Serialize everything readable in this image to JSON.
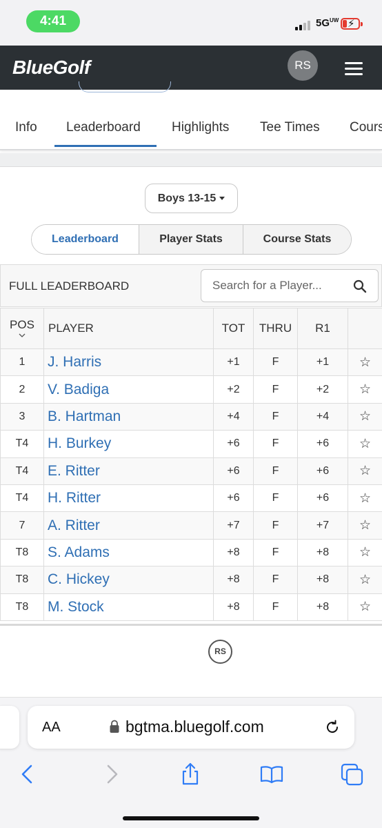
{
  "status_bar": {
    "time": "4:41",
    "network": "5G",
    "network_suffix": "UW",
    "battery_color": "#e43a2f"
  },
  "header": {
    "logo": "BlueGolf",
    "avatar_initials": "RS",
    "background": "#2b3034"
  },
  "tabs": [
    {
      "label": "Info",
      "active": false
    },
    {
      "label": "Leaderboard",
      "active": true
    },
    {
      "label": "Highlights",
      "active": false
    },
    {
      "label": "Tee Times",
      "active": false
    },
    {
      "label": "Cours",
      "active": false
    }
  ],
  "division": {
    "selected": "Boys 13-15"
  },
  "segments": [
    {
      "label": "Leaderboard",
      "active": true
    },
    {
      "label": "Player Stats",
      "active": false
    },
    {
      "label": "Course Stats",
      "active": false
    }
  ],
  "leaderboard": {
    "title": "FULL LEADERBOARD",
    "search_placeholder": "Search for a Player...",
    "columns": [
      "POS",
      "PLAYER",
      "TOT",
      "THRU",
      "R1"
    ],
    "rows": [
      {
        "pos": "1",
        "player": "J. Harris",
        "tot": "+1",
        "thru": "F",
        "r1": "+1"
      },
      {
        "pos": "2",
        "player": "V. Badiga",
        "tot": "+2",
        "thru": "F",
        "r1": "+2"
      },
      {
        "pos": "3",
        "player": "B. Hartman",
        "tot": "+4",
        "thru": "F",
        "r1": "+4"
      },
      {
        "pos": "T4",
        "player": "H. Burkey",
        "tot": "+6",
        "thru": "F",
        "r1": "+6"
      },
      {
        "pos": "T4",
        "player": "E. Ritter",
        "tot": "+6",
        "thru": "F",
        "r1": "+6"
      },
      {
        "pos": "T4",
        "player": "H. Ritter",
        "tot": "+6",
        "thru": "F",
        "r1": "+6"
      },
      {
        "pos": "7",
        "player": "A. Ritter",
        "tot": "+7",
        "thru": "F",
        "r1": "+7"
      },
      {
        "pos": "T8",
        "player": "S. Adams",
        "tot": "+8",
        "thru": "F",
        "r1": "+8"
      },
      {
        "pos": "T8",
        "player": "C. Hickey",
        "tot": "+8",
        "thru": "F",
        "r1": "+8"
      },
      {
        "pos": "T8",
        "player": "M. Stock",
        "tot": "+8",
        "thru": "F",
        "r1": "+8"
      }
    ],
    "star_icon": "star-outline-icon"
  },
  "footer_badge": "RS",
  "safari": {
    "aa_label": "AA",
    "url": "bgtma.bluegolf.com",
    "accent": "#2f7cf6"
  },
  "colors": {
    "link": "#2f6fb4",
    "active_tab_underline": "#2f6fb4"
  }
}
